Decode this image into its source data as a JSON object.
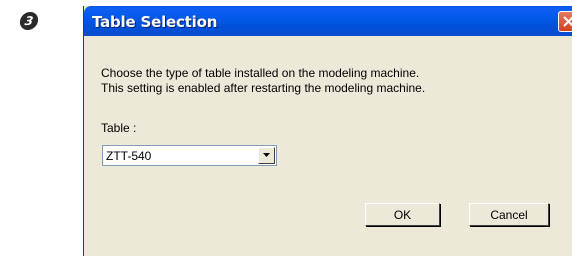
{
  "step_badge": "3",
  "dialog": {
    "title": "Table Selection",
    "description_line1": "Choose the type of table installed on the modeling machine.",
    "description_line2": "This setting is enabled after restarting the modeling machine.",
    "table_label": "Table :",
    "table_value": "ZTT-540",
    "ok_label": "OK",
    "cancel_label": "Cancel"
  },
  "icons": {
    "close": "close-icon",
    "dropdown": "chevron-down-icon"
  },
  "colors": {
    "titlebar": "#0058e6",
    "window_face": "#ece9d8",
    "close_button": "#d3421e"
  }
}
